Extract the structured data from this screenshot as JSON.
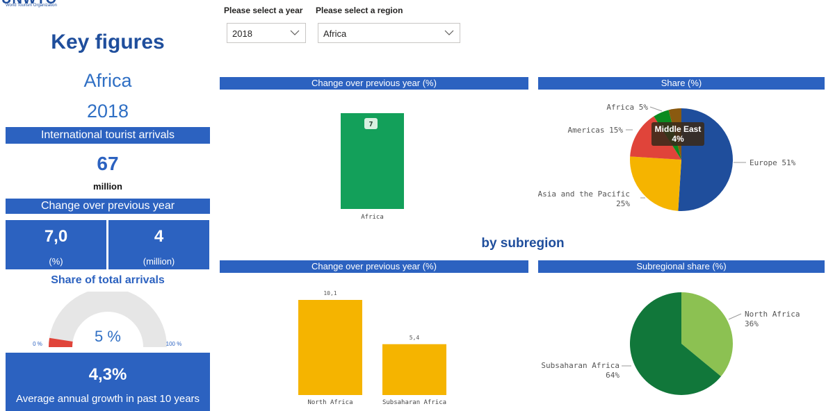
{
  "logo": {
    "name": "UNWTO",
    "subtitle": "World Tourism Organization"
  },
  "key_figures": {
    "title": "Key figures",
    "region": "Africa",
    "year": "2018",
    "arrivals_header": "International tourist arrivals",
    "arrivals_value": "67",
    "arrivals_unit": "million",
    "change_header": "Change over previous year",
    "change_pct_value": "7,0",
    "change_pct_unit": "(%)",
    "change_million_value": "4",
    "change_million_unit": "(million)",
    "share_title": "Share of total arrivals",
    "gauge": {
      "value_label": "5 %",
      "value": 5,
      "min_label": "0 %",
      "max_label": "100 %",
      "min": 0,
      "max": 100
    },
    "growth_value": "4,3%",
    "growth_label": "Average annual growth in past 10 years"
  },
  "filters": {
    "year_label": "Please select a year",
    "year_value": "2018",
    "region_label": "Please select a region",
    "region_value": "Africa"
  },
  "colors": {
    "brand_blue": "#2c62c0",
    "dark_blue": "#1f4e9c",
    "green": "#13a05a",
    "gold": "#f5b400"
  },
  "headers": {
    "change_region": "Change over previous year (%)",
    "share": "Share (%)",
    "by_subregion": "by subregion",
    "change_subregion": "Change over previous year (%)",
    "subregional_share": "Subregional share (%)"
  },
  "chart_data": [
    {
      "type": "bar",
      "title": "Change over previous year (%)",
      "categories": [
        "Africa"
      ],
      "values": [
        7
      ],
      "data_labels": [
        "7"
      ],
      "color": "#13a05a"
    },
    {
      "type": "pie",
      "title": "Share (%)",
      "slices": [
        {
          "label": "Europe",
          "value": 51,
          "display": "Europe 51%",
          "color": "#1f4e9c"
        },
        {
          "label": "Asia and the Pacific",
          "value": 25,
          "display_line1": "Asia and the Pacific",
          "display_line2": "25%",
          "color": "#f5b400"
        },
        {
          "label": "Americas",
          "value": 15,
          "display": "Americas 15%",
          "color": "#e0443a"
        },
        {
          "label": "Africa",
          "value": 5,
          "display": "Africa 5%",
          "color": "#0b8a1f"
        },
        {
          "label": "Middle East",
          "value": 4,
          "color": "#8a5a10"
        }
      ],
      "tooltip": {
        "title": "Middle East",
        "value": "4%"
      }
    },
    {
      "type": "bar",
      "title": "Change over previous year (%)",
      "categories": [
        "North Africa",
        "Subsaharan Africa"
      ],
      "values": [
        10.1,
        5.4
      ],
      "data_labels": [
        "10,1",
        "5,4"
      ],
      "color": "#f5b400"
    },
    {
      "type": "pie",
      "title": "Subregional share (%)",
      "slices": [
        {
          "label": "North Africa",
          "value": 36,
          "display_line1": "North Africa",
          "display_line2": "36%",
          "color": "#8cc152"
        },
        {
          "label": "Subsaharan Africa",
          "value": 64,
          "display_line1": "Subsaharan Africa",
          "display_line2": "64%",
          "color": "#11773a"
        }
      ]
    }
  ]
}
